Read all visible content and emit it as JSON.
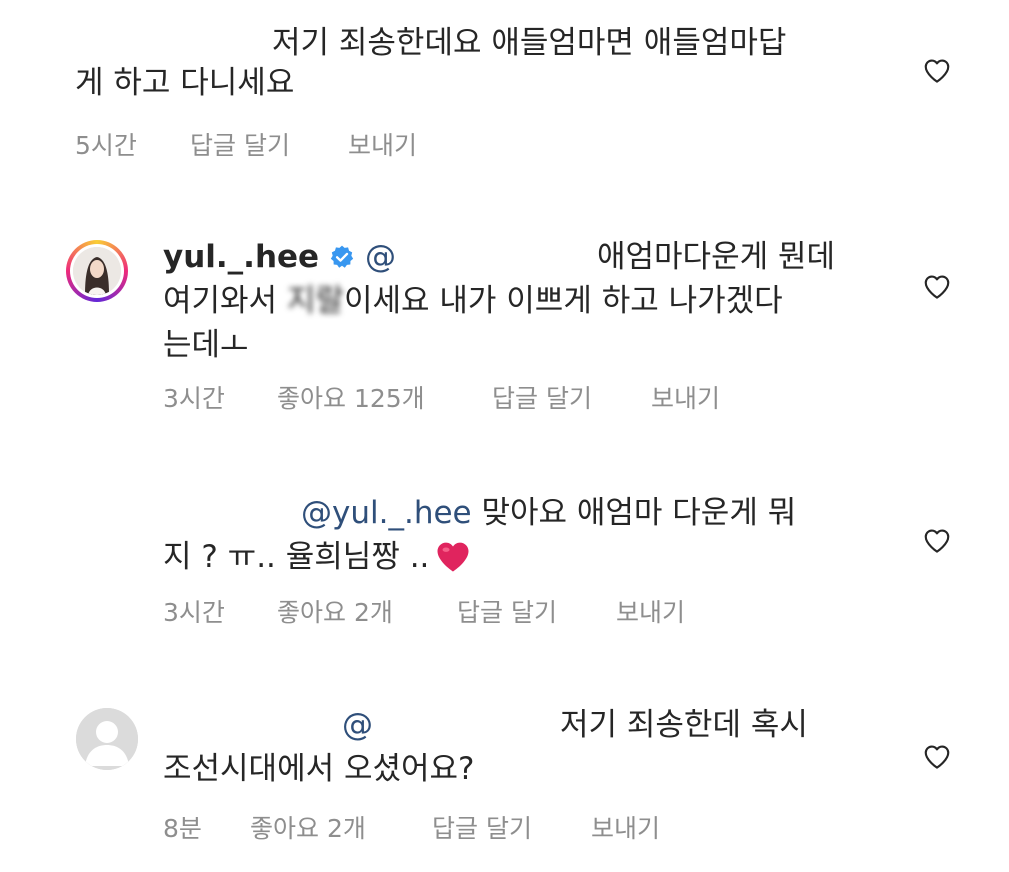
{
  "comments": [
    {
      "line1": "저기  죄송한데요 애들엄마면 애들엄마답",
      "line2": "게 하고 다니세요",
      "time": "5시간",
      "reply": "답글 달기",
      "send": "보내기"
    },
    {
      "username": "yul._.hee",
      "at": "@",
      "line1_rest": "애엄마다운게 뭔데",
      "line2_a": "여기와서 ",
      "line2_b": "지랄",
      "line2_c": "이세요 내가 이쁘게 하고 나가겠다",
      "line3": "는데ㅗ",
      "time": "3시간",
      "likes": "좋아요 125개",
      "reply": "답글 달기",
      "send": "보내기"
    },
    {
      "mention": "@yul._.hee",
      "line1_rest": " 맞아요 애엄마 다운게 뭐",
      "line2": "지 ? ㅠ.. 율희님짱 ..",
      "emoji": "❤️",
      "time": "3시간",
      "likes": "좋아요 2개",
      "reply": "답글 달기",
      "send": "보내기"
    },
    {
      "at": "@",
      "line1_rest": "저기 죄송한데 혹시",
      "line2": "조선시대에서 오셨어요?",
      "time": "8분",
      "likes": "좋아요 2개",
      "reply": "답글 달기",
      "send": "보내기"
    }
  ],
  "icons": {
    "like": "heart-outline-icon",
    "verified": "verified-badge-icon"
  },
  "colors": {
    "text": "#262626",
    "meta": "#8e8e8e",
    "mention": "#2f4f7a",
    "verified": "#3897f0"
  }
}
